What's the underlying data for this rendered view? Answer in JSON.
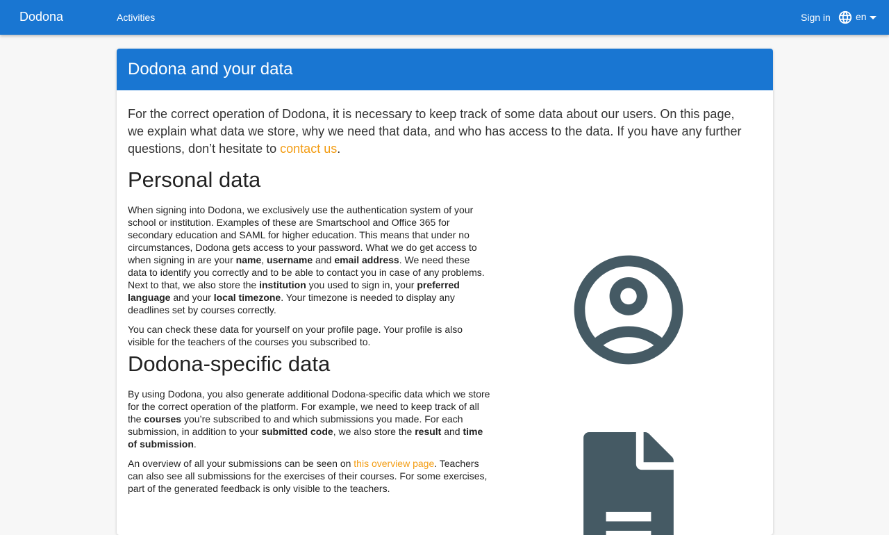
{
  "navbar": {
    "brand": "Dodona",
    "activities": "Activities",
    "sign_in": "Sign in",
    "language": "en",
    "language_icon": "globe-icon",
    "caret_icon": "caret-down-icon"
  },
  "page": {
    "title": "Dodona and your data",
    "intro": {
      "before_link": "For the correct operation of Dodona, it is necessary to keep track of some data about our users. On this page, we explain what data we store, why we need that data, and who has access to the data. If you have any further questions, don’t hesitate to ",
      "link": "contact us",
      "after_link": "."
    },
    "personal": {
      "heading": "Personal data",
      "p1_a": "When signing into Dodona, we exclusively use the authentication system of your school or institution. Examples of these are Smartschool and Office 365 for secondary education and SAML for higher education. This means that under no circumstances, Dodona gets access to your password. What we do get access to when signing in are your ",
      "p1_name": "name",
      "p1_b": ", ",
      "p1_username": "username",
      "p1_c": " and ",
      "p1_email": "email address",
      "p1_d": ". We need these data to identify you correctly and to be able to contact you in case of any problems. Next to that, we also store the ",
      "p1_institution": "institution",
      "p1_e": " you used to sign in, your ",
      "p1_language": "preferred language",
      "p1_f": " and your ",
      "p1_timezone": "local timezone",
      "p1_g": ". Your timezone is needed to display any deadlines set by courses correctly.",
      "p2": "You can check these data for yourself on your profile page. Your profile is also visible for the teachers of the courses you subscribed to.",
      "icon": "account-circle-icon"
    },
    "dodona_specific": {
      "heading": "Dodona-specific data",
      "p1_a": "By using Dodona, you also generate additional Dodona-specific data which we store for the correct operation of the platform. For example, we need to keep track of all the ",
      "p1_courses": "courses",
      "p1_b": " you’re subscribed to and which submissions you made. For each submission, in addition to your ",
      "p1_code": "submitted code",
      "p1_c": ", we also store the ",
      "p1_result": "result",
      "p1_d": " and ",
      "p1_time": "time of submission",
      "p1_e": ".",
      "p2_a": "An overview of all your submissions can be seen on ",
      "p2_link": "this overview page",
      "p2_b": ". Teachers can also see all submissions for the exercises of their courses. For some exercises, part of the generated feedback is only visible to the teachers.",
      "icon": "document-icon"
    }
  },
  "colors": {
    "primary": "#1976d2",
    "accent": "#f39c12",
    "icon": "#455a64",
    "background": "#f7f7f7"
  }
}
